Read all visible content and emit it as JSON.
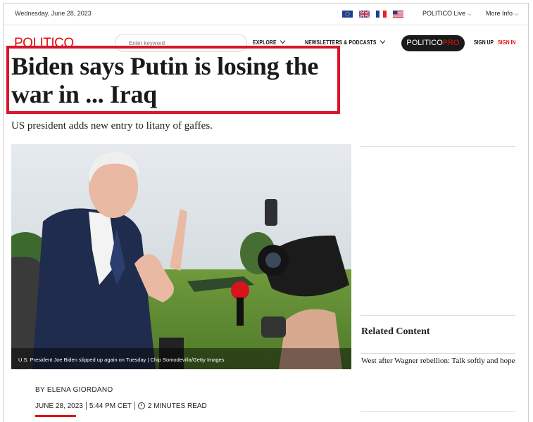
{
  "utility_bar": {
    "date": "Wednesday, June 28, 2023",
    "live_label": "POLITICO Live",
    "more_info_label": "More Info"
  },
  "nav": {
    "logo": "POLITICO",
    "search_placeholder": "Enter keyword",
    "explore": "EXPLORE",
    "newsletters": "NEWSLETTERS & PODCASTS",
    "pro_prefix": "POLITICO",
    "pro_suffix": "PRO",
    "signup": "SIGN UP",
    "signin": "SIGN IN"
  },
  "article": {
    "headline": "Biden says Putin is losing the war in ... Iraq",
    "dek": "US president adds new entry to litany of gaffes.",
    "photo_caption": "U.S. President Joe Biden slipped up again on Tuesday | Chip Somodevilla/Getty Images",
    "byline": "BY ELENA GIORDANO",
    "date": "JUNE 28, 2023",
    "time": "5:44 PM CET",
    "read_time": "2 MINUTES READ"
  },
  "sidebar": {
    "related_title": "Related Content",
    "related_item": "West after Wagner rebellion: Talk softly and hope"
  },
  "colors": {
    "brand_red": "#e3120b",
    "highlight_border": "#d9142b"
  },
  "icons": [
    "eu-flag-icon",
    "uk-flag-icon",
    "france-flag-icon",
    "us-flag-icon",
    "chevron-down-icon",
    "clock-icon"
  ]
}
